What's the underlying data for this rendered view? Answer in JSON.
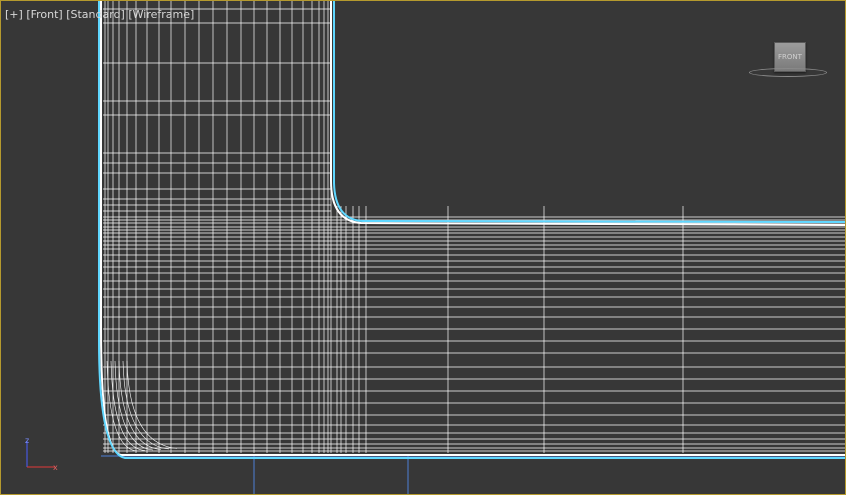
{
  "viewport": {
    "label_parts": [
      "[+]",
      "[Front]",
      "[Standard]",
      "[Wireframe]"
    ]
  },
  "viewcube": {
    "face_label": "FRONT"
  },
  "axis_tripod": {
    "z_label": "z",
    "x_label": "x"
  },
  "colors": {
    "viewport_bg": "#373737",
    "wire": "#ffffff",
    "selection_outline": "#5fd7ff",
    "active_border": "#b59a2e",
    "grid_line": "#4d7fd6"
  }
}
